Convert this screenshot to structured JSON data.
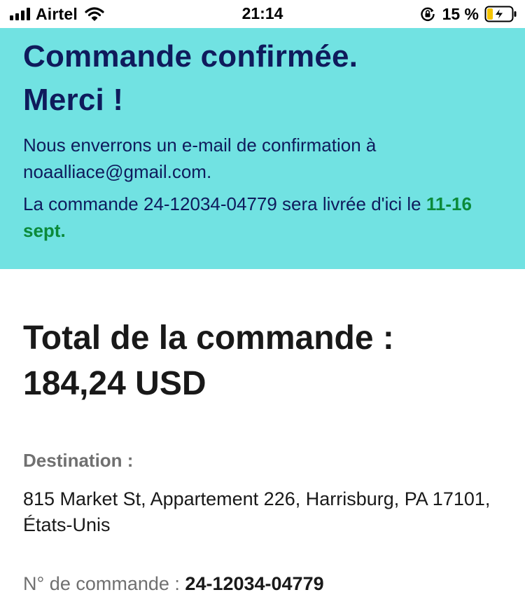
{
  "status_bar": {
    "carrier": "Airtel",
    "time": "21:14",
    "battery_percent": "15 %",
    "icons": [
      "signal-icon",
      "wifi-icon",
      "rotation-lock-icon",
      "battery-charging-icon"
    ]
  },
  "banner": {
    "title_line1": "Commande confirmée.",
    "title_line2": "Merci !",
    "email_message": "Nous enverrons un e-mail de confirmation à noaalliace@gmail.com.",
    "delivery_message": "La commande 24-12034-04779 sera livrée d'ici le",
    "delivery_date": "11-16 sept.",
    "background_color": "#71e2e2",
    "text_color": "#0f1b5c",
    "date_color": "#0b8a3a"
  },
  "order": {
    "total_label": "Total de la commande :",
    "total_value": "184,24 USD",
    "destination_label": "Destination :",
    "destination_address": "815 Market St, Appartement 226, Harrisburg, PA 17101, États-Unis",
    "order_number_label": "N° de commande :",
    "order_number_value": "24-12034-04779"
  }
}
